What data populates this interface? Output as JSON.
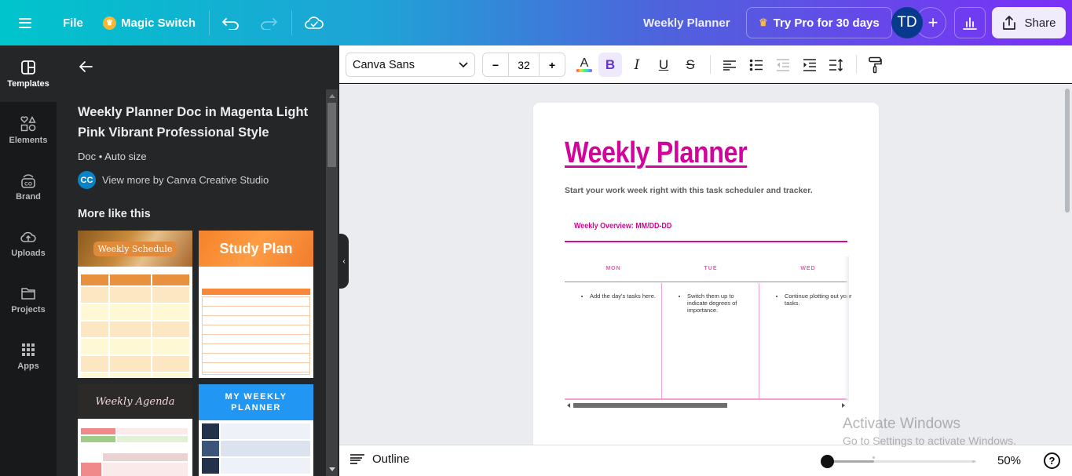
{
  "topbar": {
    "file_label": "File",
    "magic_switch_label": "Magic Switch",
    "document_title": "Weekly Planner",
    "try_pro_label": "Try Pro for 30 days",
    "avatar_initials": "TD",
    "share_label": "Share",
    "gradient_colors": [
      "#00c4cc",
      "#7b2ff7"
    ]
  },
  "rail": {
    "items": [
      {
        "label": "Templates",
        "icon": "templates-icon",
        "active": true
      },
      {
        "label": "Elements",
        "icon": "elements-icon"
      },
      {
        "label": "Brand",
        "icon": "brand-icon"
      },
      {
        "label": "Uploads",
        "icon": "uploads-icon"
      },
      {
        "label": "Projects",
        "icon": "projects-icon"
      },
      {
        "label": "Apps",
        "icon": "apps-icon"
      }
    ]
  },
  "panel": {
    "template_title": "Weekly Planner Doc in Magenta Light Pink Vibrant Professional Style",
    "template_meta": "Doc • Auto size",
    "author_initials": "CC",
    "author_link": "View more by Canva Creative Studio",
    "more_like_this": "More like this",
    "thumbnails": [
      {
        "title": "Weekly Schedule"
      },
      {
        "title": "Study Plan"
      },
      {
        "title": "Weekly Agenda"
      },
      {
        "title": "MY WEEKLY PLANNER"
      }
    ]
  },
  "toolbar": {
    "font_family": "Canva Sans",
    "font_size": "32",
    "minus_label": "−",
    "plus_label": "+",
    "bold_label": "B",
    "italic_label": "I",
    "underline_label": "U",
    "strike_label": "S",
    "text_color_label": "A"
  },
  "document": {
    "title": "Weekly Planner",
    "subtitle": "Start your work week right with this task scheduler and tracker.",
    "overview": "Weekly Overview: MM/DD-DD",
    "accent_color": "#d3049b",
    "days": [
      {
        "name": "MON",
        "task": "Add the day's tasks here."
      },
      {
        "name": "TUE",
        "task": "Switch them up to indicate degrees of importance."
      },
      {
        "name": "WED",
        "task": "Continue plotting out your tasks."
      }
    ]
  },
  "bottombar": {
    "outline_label": "Outline",
    "zoom_percent": "50%",
    "zoom_value": 0.5,
    "help_label": "?"
  },
  "watermark": {
    "line1": "Activate Windows",
    "line2": "Go to Settings to activate Windows."
  }
}
